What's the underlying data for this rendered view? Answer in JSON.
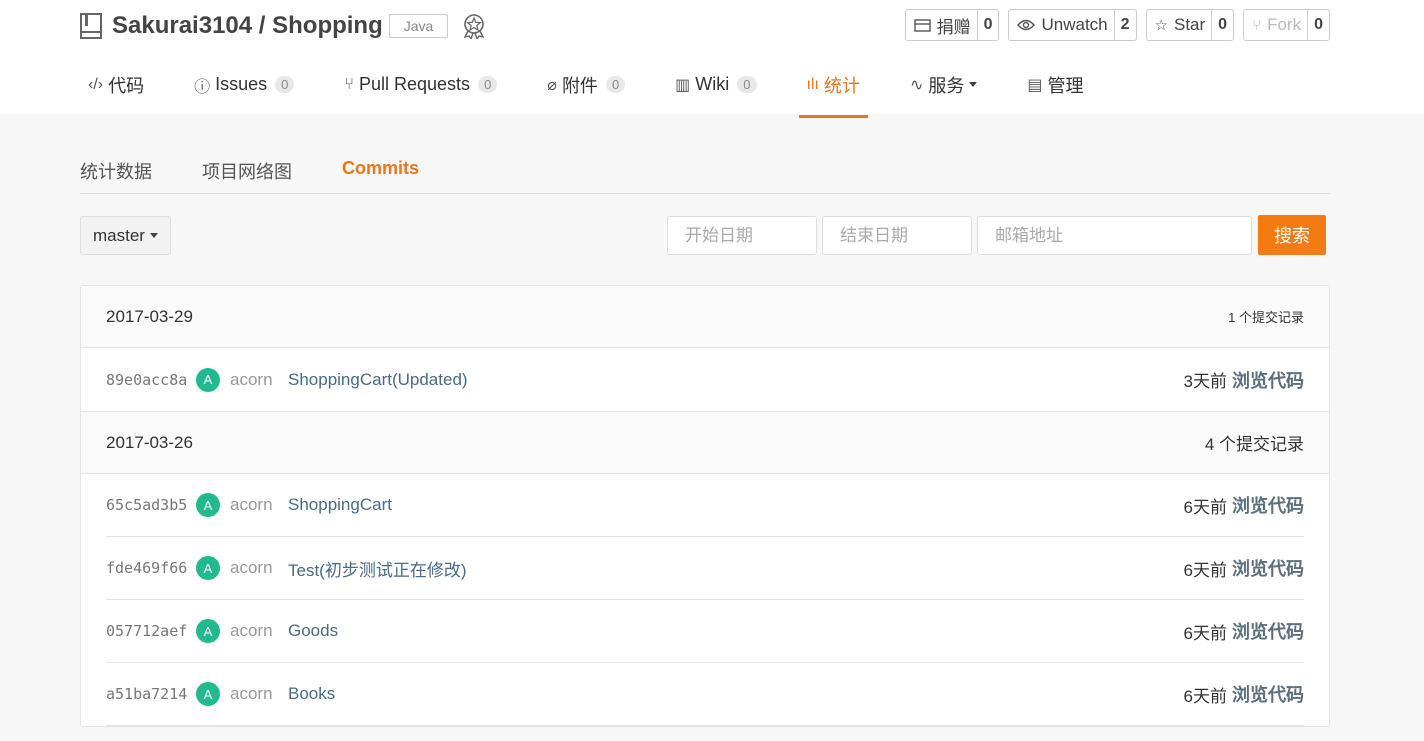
{
  "repo": {
    "owner_name": "Sakurai3104 / Shopping",
    "language": "Java"
  },
  "actions": [
    {
      "label": "捐赠",
      "count": "0",
      "icon": "credit-card-icon"
    },
    {
      "label": "Unwatch",
      "count": "2",
      "icon": "eye-icon"
    },
    {
      "label": "Star",
      "count": "0",
      "icon": "star-icon"
    },
    {
      "label": "Fork",
      "count": "0",
      "icon": "fork-icon"
    }
  ],
  "tabs": [
    {
      "label": "代码",
      "icon": "code-icon",
      "icon_char": "‹/›"
    },
    {
      "label": "Issues",
      "count": "0",
      "icon": "issue-icon",
      "icon_char": "ⓘ"
    },
    {
      "label": "Pull Requests",
      "count": "0",
      "icon": "pull-request-icon",
      "icon_char": "⑂"
    },
    {
      "label": "附件",
      "count": "0",
      "icon": "paperclip-icon",
      "icon_char": "⌀"
    },
    {
      "label": "Wiki",
      "count": "0",
      "icon": "book-icon",
      "icon_char": "▥"
    },
    {
      "label": "统计",
      "icon": "bar-chart-icon",
      "icon_char": "ılı"
    },
    {
      "label": "服务",
      "icon": "pulse-icon",
      "icon_char": "∿"
    },
    {
      "label": "管理",
      "icon": "settings-doc-icon",
      "icon_char": "▤"
    }
  ],
  "subnav": [
    "统计数据",
    "项目网络图",
    "Commits"
  ],
  "filters": {
    "branch": "master",
    "start_date_placeholder": "开始日期",
    "end_date_placeholder": "结束日期",
    "email_placeholder": "邮箱地址",
    "search_label": "搜索"
  },
  "commit_groups": [
    {
      "date": "2017-03-29",
      "count_text": "1 个提交记录",
      "commits": [
        {
          "sha": "89e0acc8a",
          "avatar": "A",
          "author": "acorn",
          "message": "ShoppingCart(Updated)",
          "time": "3天前",
          "browse": "浏览代码"
        }
      ]
    },
    {
      "date": "2017-03-26",
      "count_text": "4 个提交记录",
      "commits": [
        {
          "sha": "65c5ad3b5",
          "avatar": "A",
          "author": "acorn",
          "message": "ShoppingCart",
          "time": "6天前",
          "browse": "浏览代码"
        },
        {
          "sha": "fde469f66",
          "avatar": "A",
          "author": "acorn",
          "message": "Test(初步测试正在修改)",
          "time": "6天前",
          "browse": "浏览代码"
        },
        {
          "sha": "057712aef",
          "avatar": "A",
          "author": "acorn",
          "message": "Goods",
          "time": "6天前",
          "browse": "浏览代码"
        },
        {
          "sha": "a51ba7214",
          "avatar": "A",
          "author": "acorn",
          "message": "Books",
          "time": "6天前",
          "browse": "浏览代码"
        }
      ]
    }
  ],
  "colors": {
    "accent": "#f0741c",
    "avatar": "#21ba8f",
    "search_button": "#f47b13"
  }
}
